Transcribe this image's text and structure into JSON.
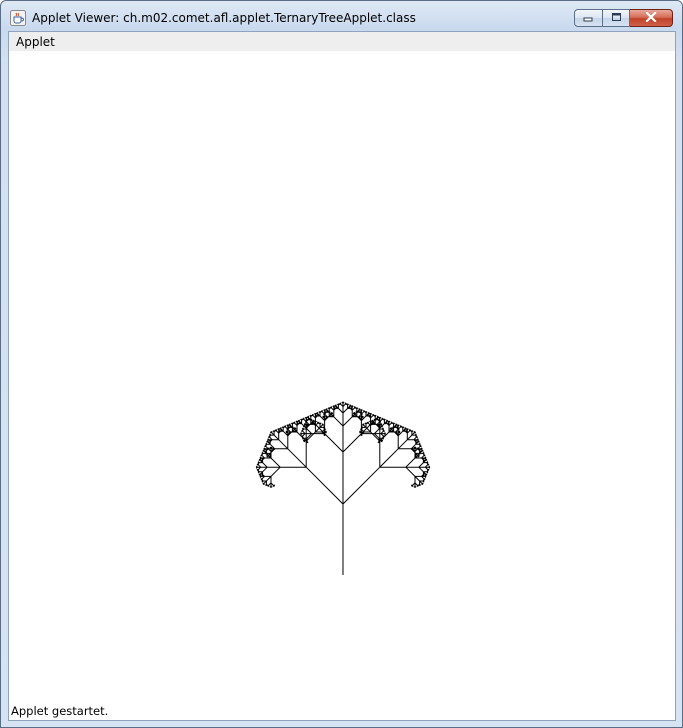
{
  "window": {
    "title": "Applet Viewer: ch.m02.comet.afl.applet.TernaryTreeApplet.class",
    "controls": [
      "minimize",
      "maximize",
      "close"
    ]
  },
  "menubar": {
    "items": [
      {
        "label": "Applet"
      }
    ]
  },
  "status": {
    "text": "Applet gestartet."
  },
  "colors": {
    "tree_stroke": "#000000",
    "canvas_bg": "#ffffff"
  },
  "icons": {
    "app": "java-cup-icon",
    "minimize": "minimize-icon",
    "maximize": "maximize-icon",
    "close": "close-icon"
  }
}
